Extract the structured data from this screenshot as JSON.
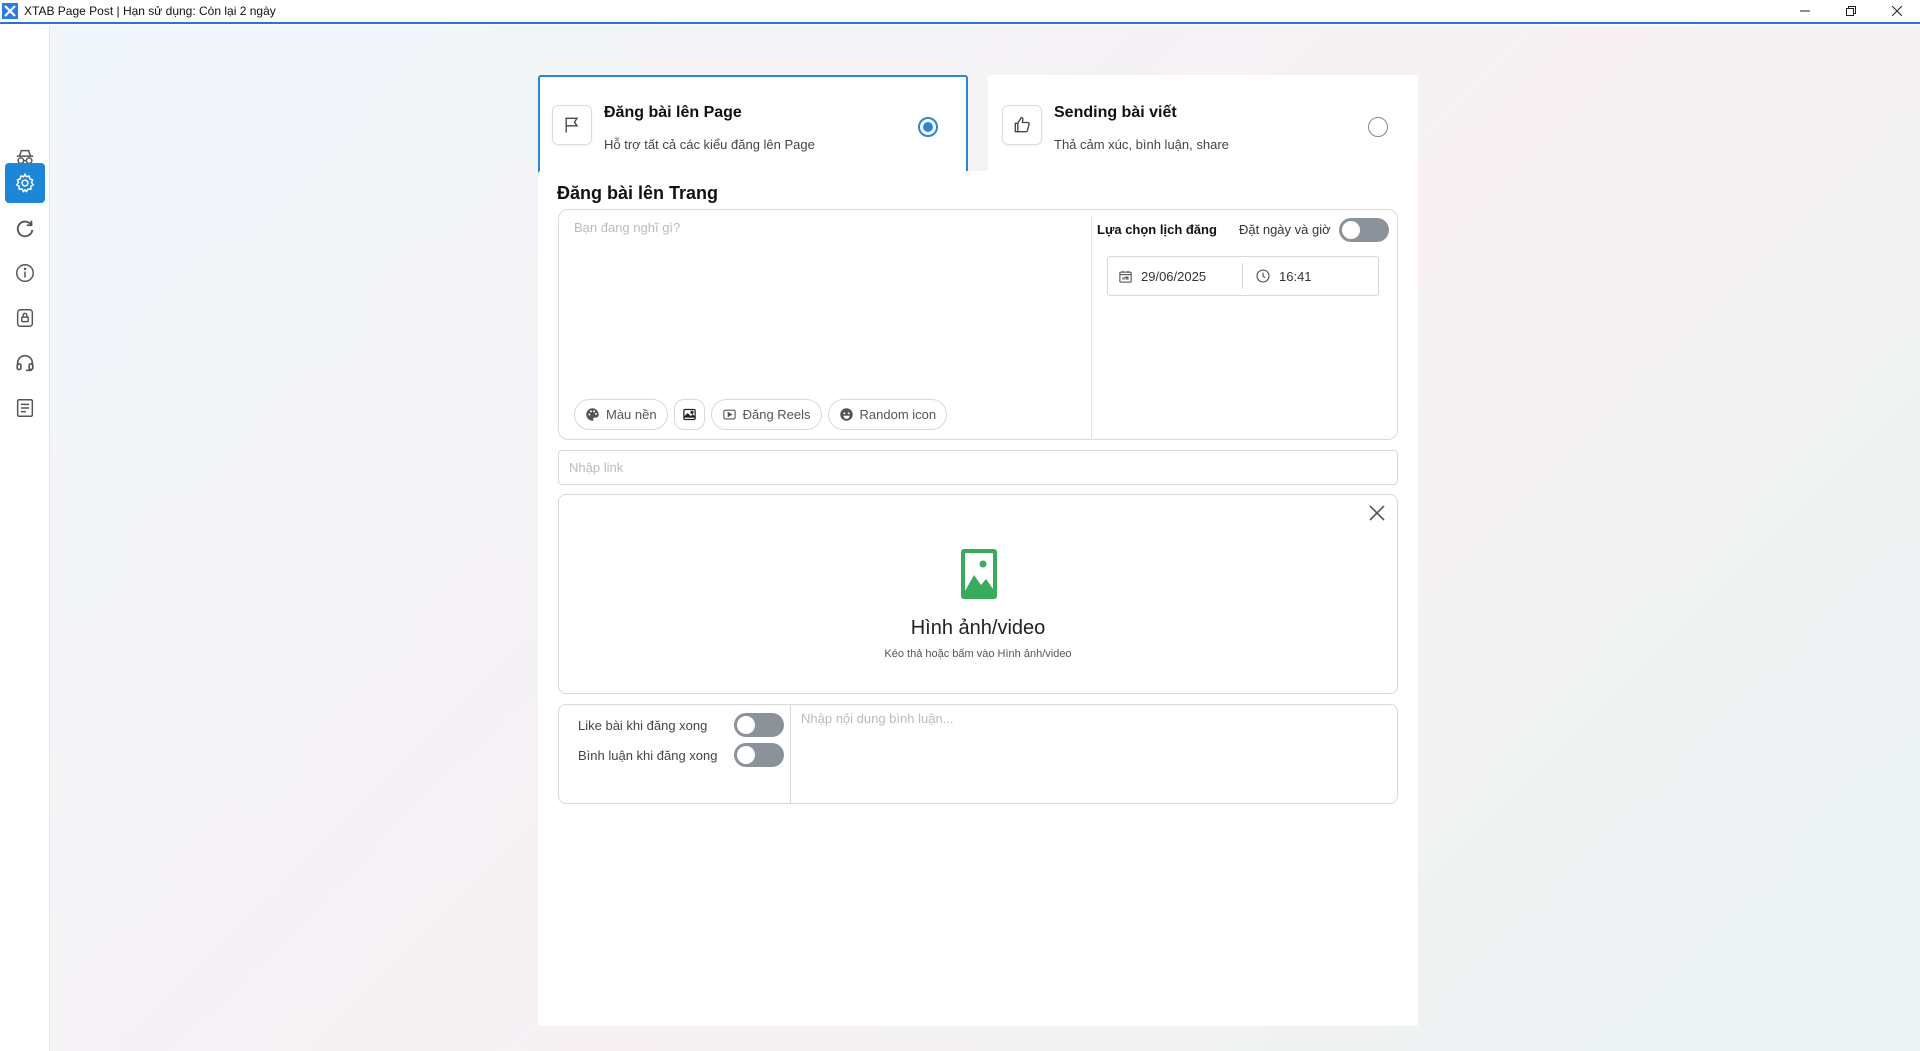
{
  "window": {
    "title": "XTAB Page Post | Hạn sử dụng: Còn lại 2 ngày",
    "controls": [
      "minimize",
      "restore",
      "close"
    ]
  },
  "sidebar": {
    "items": [
      {
        "name": "incognito",
        "icon": "spy-icon",
        "active": false
      },
      {
        "name": "settings",
        "icon": "gear-icon",
        "active": true
      },
      {
        "name": "refresh",
        "icon": "refresh-icon",
        "active": false
      },
      {
        "name": "info",
        "icon": "info-icon",
        "active": false
      },
      {
        "name": "lock",
        "icon": "lock-icon",
        "active": false
      },
      {
        "name": "support",
        "icon": "headset-icon",
        "active": false
      },
      {
        "name": "log",
        "icon": "document-icon",
        "active": false
      }
    ]
  },
  "modes": [
    {
      "title": "Đăng bài lên Page",
      "subtitle": "Hỗ trợ tất cả các kiểu đăng lên Page",
      "icon": "flag-icon",
      "selected": true
    },
    {
      "title": "Sending bài viết",
      "subtitle": "Thả cảm xúc, bình luận, share",
      "icon": "thumbs-up-icon",
      "selected": false
    }
  ],
  "panel": {
    "title": "Đăng bài lên Trang",
    "compose_placeholder": "Bạn đang nghĩ gì?",
    "compose_value": "",
    "tools": {
      "background": "Màu nền",
      "image_icon": "image-icon",
      "reels": "Đăng Reels",
      "random_icon": "Random icon"
    },
    "schedule": {
      "label": "Lựa chọn lịch đăng",
      "toggle_label": "Đặt ngày và giờ",
      "toggle_on": false,
      "date": "29/06/2025",
      "time": "16:41"
    },
    "link_placeholder": "Nhập link",
    "media": {
      "title": "Hình ảnh/video",
      "subtitle": "Kéo thả hoặc bấm vào Hình ảnh/video",
      "icon_color": "#3aaa5c"
    },
    "after_post": {
      "like_label": "Like bài khi đăng xong",
      "like_on": false,
      "comment_label": "Bình luận khi đăng xong",
      "comment_on": false,
      "comment_placeholder": "Nhập nội dung bình luận..."
    }
  },
  "colors": {
    "accent": "#1e86d6",
    "toggle_off": "#8c9299",
    "title_border": "#2f6fd6"
  }
}
